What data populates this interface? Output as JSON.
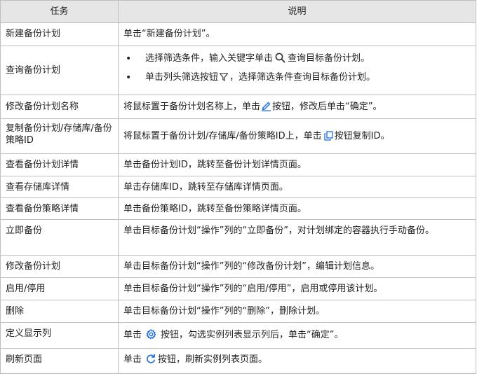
{
  "headers": {
    "task": "任务",
    "desc": "说明"
  },
  "rows": {
    "r1": {
      "task": "新建备份计划",
      "desc": "单击“新建备份计划”。"
    },
    "r2": {
      "task": "查询备份计划",
      "b1_a": "选择筛选条件，输入关键字单击",
      "b1_b": "查询目标备份计划。",
      "b2_a": "单击列头筛选按钮",
      "b2_b": "，选择筛选条件查询目标备份计划。"
    },
    "r3": {
      "task": "修改备份计划名称",
      "desc_a": "将鼠标置于备份计划名称上，单击",
      "desc_b": "按钮，修改后单击“确定”。"
    },
    "r4": {
      "task": "复制备份计划/存储库/备份策略ID",
      "desc_a": "将鼠标置于备份计划/存储库/备份策略ID上，单击",
      "desc_b": "按钮复制ID。"
    },
    "r5": {
      "task": "查看备份计划详情",
      "desc": "单击备份计划ID，跳转至备份计划详情页面。"
    },
    "r6": {
      "task": "查看存储库详情",
      "desc": "单击存储库ID，跳转至存储库详情页面。"
    },
    "r7": {
      "task": "查看备份策略详情",
      "desc": "单击备份策略ID，跳转至备份策略详情页面。"
    },
    "r8": {
      "task": "立即备份",
      "desc": "单击目标备份计划“操作”列的“立即备份”，对计划绑定的容器执行手动备份。"
    },
    "r9": {
      "task": "修改备份计划",
      "desc": "单击目标备份计划“操作”列的“修改备份计划”，编辑计划信息。"
    },
    "r10": {
      "task": "启用/停用",
      "desc": "单击目标备份计划“操作”列的“启用/停用”，启用或停用该计划。"
    },
    "r11": {
      "task": "删除",
      "desc": "单击目标备份计划“操作”列的“删除”，删除计划。"
    },
    "r12": {
      "task": "定义显示列",
      "desc_a": "单击",
      "desc_b": "按钮，勾选实例列表显示列后，单击“确定”。"
    },
    "r13": {
      "task": "刷新页面",
      "desc_a": "单击",
      "desc_b": "按钮，刷新实例列表页面。"
    }
  },
  "bullet": "•",
  "icons": {
    "search": "search-icon",
    "filter": "filter-icon",
    "edit": "edit-icon",
    "copy": "copy-icon",
    "settings": "gear-icon",
    "refresh": "refresh-icon"
  },
  "colors": {
    "header_bg": "#e6e6e6",
    "border": "#bfbfbf",
    "icon_blue": "#1c6be3",
    "icon_gray": "#444444"
  }
}
